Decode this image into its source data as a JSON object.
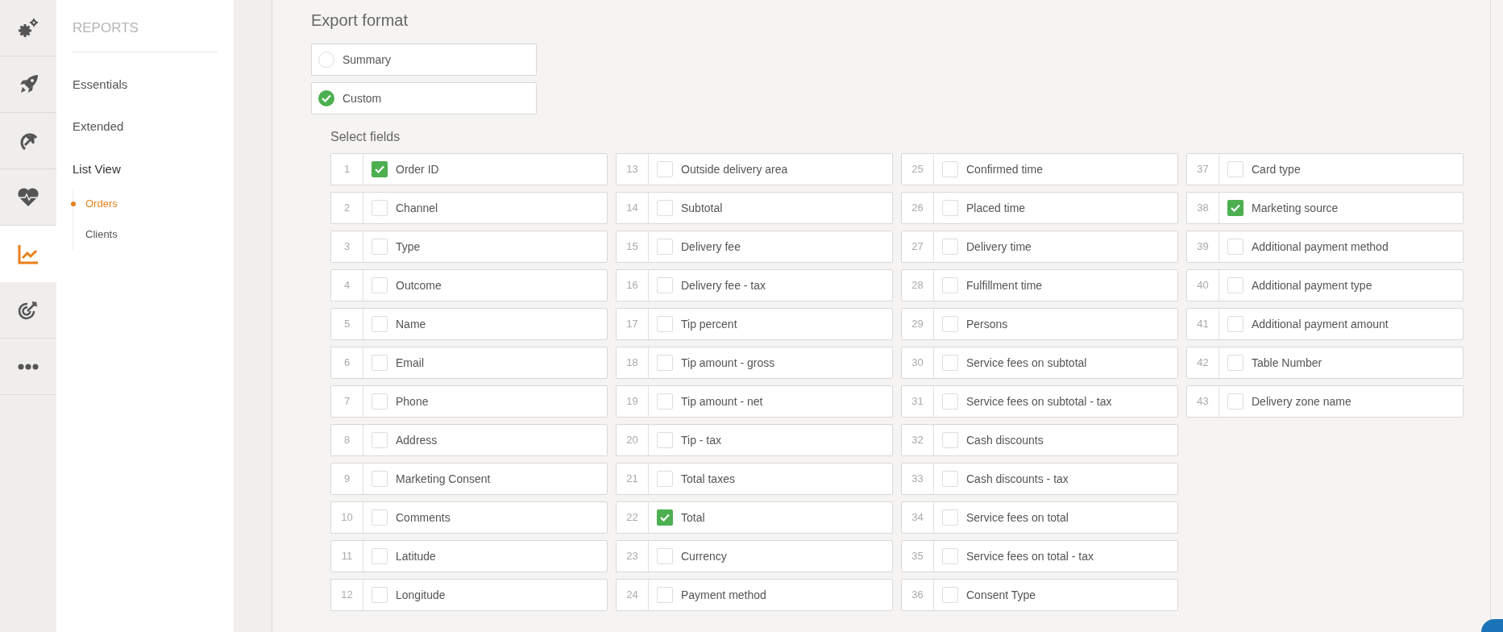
{
  "rail": [
    {
      "kind": "gears",
      "selected": false
    },
    {
      "kind": "rocket",
      "selected": false
    },
    {
      "kind": "circle-arrow",
      "selected": false
    },
    {
      "kind": "heart",
      "selected": false
    },
    {
      "kind": "chart",
      "selected": true
    },
    {
      "kind": "target",
      "selected": false
    },
    {
      "kind": "more",
      "selected": false
    }
  ],
  "sidebar": {
    "title": "REPORTS",
    "items": [
      {
        "label": "Essentials",
        "selected": false
      },
      {
        "label": "Extended",
        "selected": false
      },
      {
        "label": "List View",
        "selected": true,
        "children": [
          {
            "label": "Orders",
            "selected": true
          },
          {
            "label": "Clients",
            "selected": false
          }
        ]
      }
    ]
  },
  "export_format": {
    "title": "Export format",
    "options": [
      {
        "label": "Summary",
        "selected": false
      },
      {
        "label": "Custom",
        "selected": true
      }
    ]
  },
  "select_fields": {
    "title": "Select fields",
    "fields": [
      {
        "number": "1",
        "label": "Order ID",
        "checked": true
      },
      {
        "number": "2",
        "label": "Channel",
        "checked": false
      },
      {
        "number": "3",
        "label": "Type",
        "checked": false
      },
      {
        "number": "4",
        "label": "Outcome",
        "checked": false
      },
      {
        "number": "5",
        "label": "Name",
        "checked": false
      },
      {
        "number": "6",
        "label": "Email",
        "checked": false
      },
      {
        "number": "7",
        "label": "Phone",
        "checked": false
      },
      {
        "number": "8",
        "label": "Address",
        "checked": false
      },
      {
        "number": "9",
        "label": "Marketing Consent",
        "checked": false
      },
      {
        "number": "10",
        "label": "Comments",
        "checked": false
      },
      {
        "number": "11",
        "label": "Latitude",
        "checked": false
      },
      {
        "number": "12",
        "label": "Longitude",
        "checked": false
      },
      {
        "number": "13",
        "label": "Outside delivery area",
        "checked": false
      },
      {
        "number": "14",
        "label": "Subtotal",
        "checked": false
      },
      {
        "number": "15",
        "label": "Delivery fee",
        "checked": false
      },
      {
        "number": "16",
        "label": "Delivery fee - tax",
        "checked": false
      },
      {
        "number": "17",
        "label": "Tip percent",
        "checked": false
      },
      {
        "number": "18",
        "label": "Tip amount - gross",
        "checked": false
      },
      {
        "number": "19",
        "label": "Tip amount - net",
        "checked": false
      },
      {
        "number": "20",
        "label": "Tip - tax",
        "checked": false
      },
      {
        "number": "21",
        "label": "Total taxes",
        "checked": false
      },
      {
        "number": "22",
        "label": "Total",
        "checked": true
      },
      {
        "number": "23",
        "label": "Currency",
        "checked": false
      },
      {
        "number": "24",
        "label": "Payment method",
        "checked": false
      },
      {
        "number": "25",
        "label": "Confirmed time",
        "checked": false
      },
      {
        "number": "26",
        "label": "Placed time",
        "checked": false
      },
      {
        "number": "27",
        "label": "Delivery time",
        "checked": false
      },
      {
        "number": "28",
        "label": "Fulfillment time",
        "checked": false
      },
      {
        "number": "29",
        "label": "Persons",
        "checked": false
      },
      {
        "number": "30",
        "label": "Service fees on subtotal",
        "checked": false
      },
      {
        "number": "31",
        "label": "Service fees on subtotal - tax",
        "checked": false
      },
      {
        "number": "32",
        "label": "Cash discounts",
        "checked": false
      },
      {
        "number": "33",
        "label": "Cash discounts - tax",
        "checked": false
      },
      {
        "number": "34",
        "label": "Service fees on total",
        "checked": false
      },
      {
        "number": "35",
        "label": "Service fees on total - tax",
        "checked": false
      },
      {
        "number": "36",
        "label": "Consent Type",
        "checked": false
      },
      {
        "number": "37",
        "label": "Card type",
        "checked": false
      },
      {
        "number": "38",
        "label": "Marketing source",
        "checked": true
      },
      {
        "number": "39",
        "label": "Additional payment method",
        "checked": false
      },
      {
        "number": "40",
        "label": "Additional payment type",
        "checked": false
      },
      {
        "number": "41",
        "label": "Additional payment amount",
        "checked": false
      },
      {
        "number": "42",
        "label": "Table Number",
        "checked": false
      },
      {
        "number": "43",
        "label": "Delivery zone name",
        "checked": false
      }
    ]
  }
}
